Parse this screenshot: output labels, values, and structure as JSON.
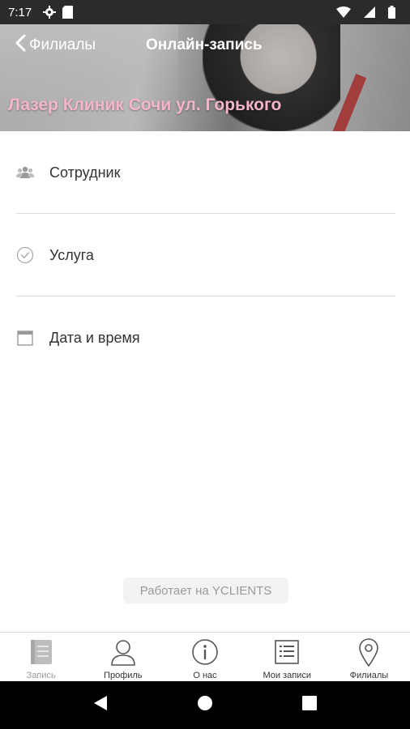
{
  "status_bar": {
    "time": "7:17",
    "icons": [
      "settings-gear-icon",
      "sd-card-icon",
      "wifi-icon",
      "signal-icon",
      "battery-icon"
    ]
  },
  "header": {
    "back_label": "Филиалы",
    "title": "Онлайн-запись",
    "branch_name": "Лазер Клиник Сочи ул. Горького"
  },
  "menu": {
    "items": [
      {
        "label": "Сотрудник",
        "icon": "staff-group-icon"
      },
      {
        "label": "Услуга",
        "icon": "service-check-icon"
      },
      {
        "label": "Дата и время",
        "icon": "calendar-icon"
      }
    ]
  },
  "footer": {
    "powered_by": "Работает на YCLIENTS"
  },
  "tabbar": {
    "tabs": [
      {
        "label": "Запись",
        "icon": "booking-book-icon",
        "active": true
      },
      {
        "label": "Профиль",
        "icon": "profile-person-icon",
        "active": false
      },
      {
        "label": "О нас",
        "icon": "info-icon",
        "active": false
      },
      {
        "label": "Мои записи",
        "icon": "my-bookings-list-icon",
        "active": false
      },
      {
        "label": "Филиалы",
        "icon": "location-pin-icon",
        "active": false
      }
    ]
  },
  "colors": {
    "branch_name": "#f4b6c8",
    "status_bar": "#2b2b2b",
    "active_tab": "#9a9a9a"
  }
}
